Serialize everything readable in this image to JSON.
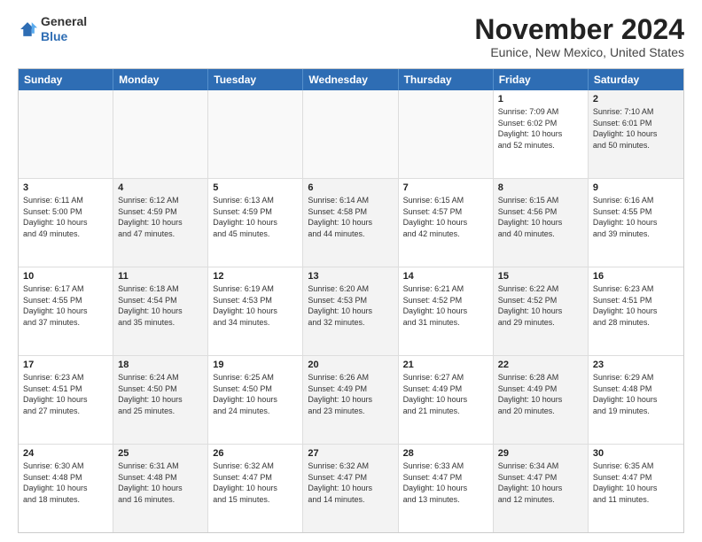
{
  "header": {
    "logo_line1": "General",
    "logo_line2": "Blue",
    "month": "November 2024",
    "location": "Eunice, New Mexico, United States"
  },
  "days_of_week": [
    "Sunday",
    "Monday",
    "Tuesday",
    "Wednesday",
    "Thursday",
    "Friday",
    "Saturday"
  ],
  "rows": [
    [
      {
        "day": "",
        "text": "",
        "empty": true
      },
      {
        "day": "",
        "text": "",
        "empty": true
      },
      {
        "day": "",
        "text": "",
        "empty": true
      },
      {
        "day": "",
        "text": "",
        "empty": true
      },
      {
        "day": "",
        "text": "",
        "empty": true
      },
      {
        "day": "1",
        "text": "Sunrise: 7:09 AM\nSunset: 6:02 PM\nDaylight: 10 hours\nand 52 minutes.",
        "empty": false,
        "shaded": false
      },
      {
        "day": "2",
        "text": "Sunrise: 7:10 AM\nSunset: 6:01 PM\nDaylight: 10 hours\nand 50 minutes.",
        "empty": false,
        "shaded": true
      }
    ],
    [
      {
        "day": "3",
        "text": "Sunrise: 6:11 AM\nSunset: 5:00 PM\nDaylight: 10 hours\nand 49 minutes.",
        "empty": false,
        "shaded": false
      },
      {
        "day": "4",
        "text": "Sunrise: 6:12 AM\nSunset: 4:59 PM\nDaylight: 10 hours\nand 47 minutes.",
        "empty": false,
        "shaded": true
      },
      {
        "day": "5",
        "text": "Sunrise: 6:13 AM\nSunset: 4:59 PM\nDaylight: 10 hours\nand 45 minutes.",
        "empty": false,
        "shaded": false
      },
      {
        "day": "6",
        "text": "Sunrise: 6:14 AM\nSunset: 4:58 PM\nDaylight: 10 hours\nand 44 minutes.",
        "empty": false,
        "shaded": true
      },
      {
        "day": "7",
        "text": "Sunrise: 6:15 AM\nSunset: 4:57 PM\nDaylight: 10 hours\nand 42 minutes.",
        "empty": false,
        "shaded": false
      },
      {
        "day": "8",
        "text": "Sunrise: 6:15 AM\nSunset: 4:56 PM\nDaylight: 10 hours\nand 40 minutes.",
        "empty": false,
        "shaded": true
      },
      {
        "day": "9",
        "text": "Sunrise: 6:16 AM\nSunset: 4:55 PM\nDaylight: 10 hours\nand 39 minutes.",
        "empty": false,
        "shaded": false
      }
    ],
    [
      {
        "day": "10",
        "text": "Sunrise: 6:17 AM\nSunset: 4:55 PM\nDaylight: 10 hours\nand 37 minutes.",
        "empty": false,
        "shaded": false
      },
      {
        "day": "11",
        "text": "Sunrise: 6:18 AM\nSunset: 4:54 PM\nDaylight: 10 hours\nand 35 minutes.",
        "empty": false,
        "shaded": true
      },
      {
        "day": "12",
        "text": "Sunrise: 6:19 AM\nSunset: 4:53 PM\nDaylight: 10 hours\nand 34 minutes.",
        "empty": false,
        "shaded": false
      },
      {
        "day": "13",
        "text": "Sunrise: 6:20 AM\nSunset: 4:53 PM\nDaylight: 10 hours\nand 32 minutes.",
        "empty": false,
        "shaded": true
      },
      {
        "day": "14",
        "text": "Sunrise: 6:21 AM\nSunset: 4:52 PM\nDaylight: 10 hours\nand 31 minutes.",
        "empty": false,
        "shaded": false
      },
      {
        "day": "15",
        "text": "Sunrise: 6:22 AM\nSunset: 4:52 PM\nDaylight: 10 hours\nand 29 minutes.",
        "empty": false,
        "shaded": true
      },
      {
        "day": "16",
        "text": "Sunrise: 6:23 AM\nSunset: 4:51 PM\nDaylight: 10 hours\nand 28 minutes.",
        "empty": false,
        "shaded": false
      }
    ],
    [
      {
        "day": "17",
        "text": "Sunrise: 6:23 AM\nSunset: 4:51 PM\nDaylight: 10 hours\nand 27 minutes.",
        "empty": false,
        "shaded": false
      },
      {
        "day": "18",
        "text": "Sunrise: 6:24 AM\nSunset: 4:50 PM\nDaylight: 10 hours\nand 25 minutes.",
        "empty": false,
        "shaded": true
      },
      {
        "day": "19",
        "text": "Sunrise: 6:25 AM\nSunset: 4:50 PM\nDaylight: 10 hours\nand 24 minutes.",
        "empty": false,
        "shaded": false
      },
      {
        "day": "20",
        "text": "Sunrise: 6:26 AM\nSunset: 4:49 PM\nDaylight: 10 hours\nand 23 minutes.",
        "empty": false,
        "shaded": true
      },
      {
        "day": "21",
        "text": "Sunrise: 6:27 AM\nSunset: 4:49 PM\nDaylight: 10 hours\nand 21 minutes.",
        "empty": false,
        "shaded": false
      },
      {
        "day": "22",
        "text": "Sunrise: 6:28 AM\nSunset: 4:49 PM\nDaylight: 10 hours\nand 20 minutes.",
        "empty": false,
        "shaded": true
      },
      {
        "day": "23",
        "text": "Sunrise: 6:29 AM\nSunset: 4:48 PM\nDaylight: 10 hours\nand 19 minutes.",
        "empty": false,
        "shaded": false
      }
    ],
    [
      {
        "day": "24",
        "text": "Sunrise: 6:30 AM\nSunset: 4:48 PM\nDaylight: 10 hours\nand 18 minutes.",
        "empty": false,
        "shaded": false
      },
      {
        "day": "25",
        "text": "Sunrise: 6:31 AM\nSunset: 4:48 PM\nDaylight: 10 hours\nand 16 minutes.",
        "empty": false,
        "shaded": true
      },
      {
        "day": "26",
        "text": "Sunrise: 6:32 AM\nSunset: 4:47 PM\nDaylight: 10 hours\nand 15 minutes.",
        "empty": false,
        "shaded": false
      },
      {
        "day": "27",
        "text": "Sunrise: 6:32 AM\nSunset: 4:47 PM\nDaylight: 10 hours\nand 14 minutes.",
        "empty": false,
        "shaded": true
      },
      {
        "day": "28",
        "text": "Sunrise: 6:33 AM\nSunset: 4:47 PM\nDaylight: 10 hours\nand 13 minutes.",
        "empty": false,
        "shaded": false
      },
      {
        "day": "29",
        "text": "Sunrise: 6:34 AM\nSunset: 4:47 PM\nDaylight: 10 hours\nand 12 minutes.",
        "empty": false,
        "shaded": true
      },
      {
        "day": "30",
        "text": "Sunrise: 6:35 AM\nSunset: 4:47 PM\nDaylight: 10 hours\nand 11 minutes.",
        "empty": false,
        "shaded": false
      }
    ]
  ]
}
